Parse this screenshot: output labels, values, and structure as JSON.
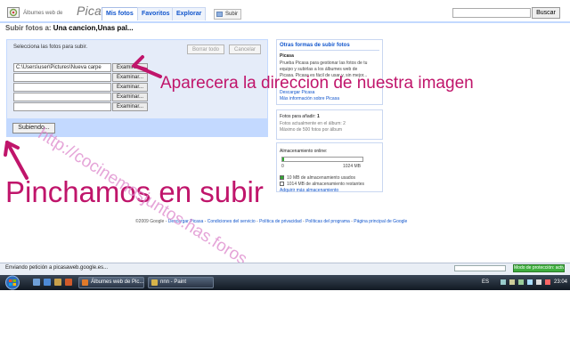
{
  "header": {
    "logo_small": "Álbumes web de",
    "logo_word": "Picasa",
    "logo_tm": "™",
    "tabs": [
      "Mis fotos",
      "Favoritos",
      "Explorar"
    ],
    "upload_label": "Subir",
    "search_value": "",
    "search_button": "Buscar"
  },
  "page": {
    "subir_label": "Subir fotos a:",
    "album_name": "Una cancion,Unas pal..."
  },
  "upload_panel": {
    "instruction": "Selecciona las fotos para subir.",
    "borrar_todo": "Borrar todo",
    "cancelar": "Cancelar",
    "file_path_1": "C:\\Users\\user\\Pictures\\Nueva carpe",
    "file_path_empty": "",
    "examinar_label": "Examinar...",
    "subiendo_label": "Subiendo..."
  },
  "right_panel": {
    "other_ways_title": "Otras formas de subir fotos",
    "picasa_title": "Picasa",
    "picasa_desc": [
      "Prueba Picasa para gestionar las fotos de tu",
      "equipo y subirlas a los álbumes web de",
      "Picasa. Picasa es fácil de usar y, sin mejor..."
    ],
    "download_link": "Descargar Picasa",
    "more_info_link": "Más información sobre Picasa",
    "photos_to_add_label": "Fotos para añadir:",
    "photos_to_add_value": "1",
    "photos_in_album": "Fotos actualmente en el álbum: 2",
    "max_photos": "Máximo de 500 fotos por álbum",
    "storage_title": "Almacenamiento online:",
    "storage_min": "0",
    "storage_max": "1024 MB",
    "storage_used_fraction": 0.01,
    "legend_used": "10 MB de almacenamiento usados",
    "legend_free": "1014 MB de almacenamiento restantes",
    "buy_more": "Adquirir más almacenamiento"
  },
  "footer": {
    "copyright": "©2009 Google",
    "links": [
      "Descargar Picasa",
      "Condiciones del servicio",
      "Política de privacidad",
      "Políticas del programa",
      "Página principal de Google"
    ]
  },
  "annotations": {
    "arrow_text_right": "Aparecera la direccion de nuestra imagen",
    "arrow_text_bottom": "Pinchamos en subir",
    "watermark": "http://cocinemosjuntos.has.foros"
  },
  "statusbar": {
    "text": "Enviando petición a picasaweb.google.es...",
    "green_label": "Modo de protección: activado"
  },
  "taskbar": {
    "windows": [
      "Álbumes web de Pic...",
      "nnn - Paint"
    ],
    "language": "ES",
    "clock": "23:04"
  },
  "colors": {
    "accent_magenta": "#c0156b",
    "picasa_blue": "#1155cc",
    "panel_blue": "#e5ecf9",
    "panel_border": "#c3d9ff"
  }
}
